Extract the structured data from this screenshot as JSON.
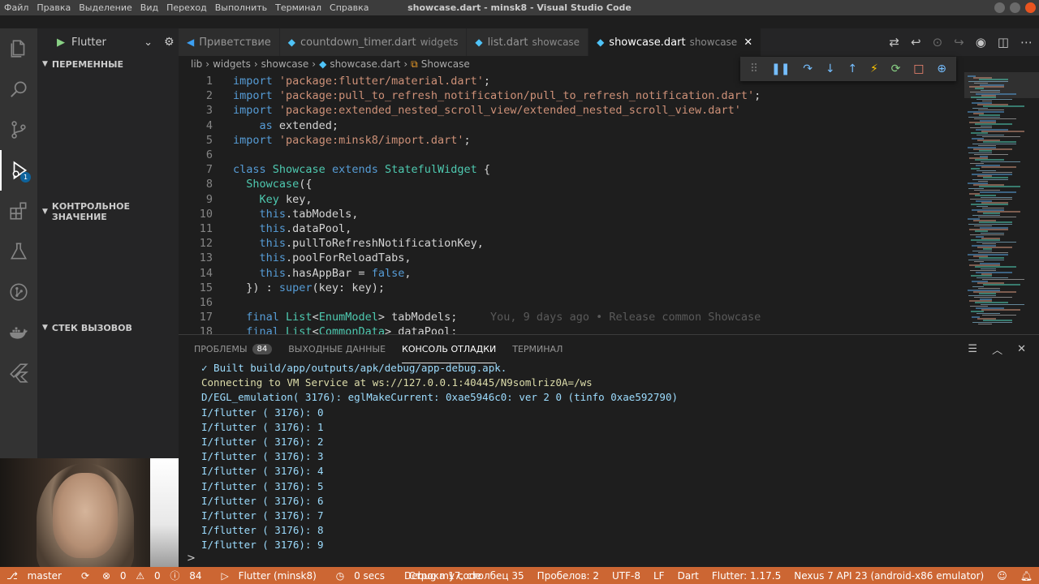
{
  "titlebar": {
    "menu": [
      "Файл",
      "Правка",
      "Выделение",
      "Вид",
      "Переход",
      "Выполнить",
      "Терминал",
      "Справка"
    ],
    "title": "showcase.dart - minsk8 - Visual Studio Code"
  },
  "activity": {
    "debug_badge": "1"
  },
  "sidebar": {
    "run_config": "Flutter",
    "sections": [
      "ПЕРЕМЕННЫЕ",
      "КОНТРОЛЬНОЕ ЗНАЧЕНИЕ",
      "СТЕК ВЫЗОВОВ"
    ]
  },
  "tabs": [
    {
      "name": "Приветствие",
      "sub": "",
      "icon": "vscode-icon"
    },
    {
      "name": "countdown_timer.dart",
      "sub": "widgets",
      "icon": "dart-icon"
    },
    {
      "name": "list.dart",
      "sub": "showcase",
      "icon": "dart-icon"
    },
    {
      "name": "showcase.dart",
      "sub": "showcase",
      "icon": "dart-icon",
      "active": true
    }
  ],
  "breadcrumb": [
    "lib",
    "widgets",
    "showcase",
    "showcase.dart",
    "Showcase"
  ],
  "editor": {
    "lines": [
      {
        "n": "1",
        "html": "<span class=\"kw\">import</span> <span class=\"str\">'package:flutter/material.dart'</span>;"
      },
      {
        "n": "2",
        "html": "<span class=\"kw\">import</span> <span class=\"str\">'package:pull_to_refresh_notification/pull_to_refresh_notification.dart'</span>;"
      },
      {
        "n": "3",
        "html": "<span class=\"kw\">import</span> <span class=\"str\">'package:extended_nested_scroll_view/extended_nested_scroll_view.dart'</span>"
      },
      {
        "n": "4",
        "html": "    <span class=\"kw\">as</span> extended;"
      },
      {
        "n": "5",
        "html": "<span class=\"kw\">import</span> <span class=\"str\">'package:minsk8/import.dart'</span>;"
      },
      {
        "n": "6",
        "html": ""
      },
      {
        "n": "7",
        "html": "<span class=\"kw\">class</span> <span class=\"cls\">Showcase</span> <span class=\"kw\">extends</span> <span class=\"cls\">StatefulWidget</span> {"
      },
      {
        "n": "8",
        "html": "  <span class=\"cls\">Showcase</span>({"
      },
      {
        "n": "9",
        "html": "    <span class=\"cls\">Key</span> key,"
      },
      {
        "n": "10",
        "html": "    <span class=\"kw\">this</span>.tabModels,"
      },
      {
        "n": "11",
        "html": "    <span class=\"kw\">this</span>.dataPool,"
      },
      {
        "n": "12",
        "html": "    <span class=\"kw\">this</span>.pullToRefreshNotificationKey,"
      },
      {
        "n": "13",
        "html": "    <span class=\"kw\">this</span>.poolForReloadTabs,"
      },
      {
        "n": "14",
        "html": "    <span class=\"kw\">this</span>.hasAppBar = <span class=\"kw\">false</span>,"
      },
      {
        "n": "15",
        "html": "  }) : <span class=\"kw\">super</span>(key: key);"
      },
      {
        "n": "16",
        "html": ""
      },
      {
        "n": "17",
        "html": "  <span class=\"kw\">final</span> <span class=\"cls\">List</span>&lt;<span class=\"cls\">EnumModel</span>&gt; tabModels;     <span class=\"blame\">You, 9 days ago • Release common Showcase</span>"
      },
      {
        "n": "18",
        "html": "  <span class=\"kw\">final</span> <span class=\"cls\">List</span>&lt;<span class=\"cls\">CommonData</span>&gt; dataPool;"
      }
    ]
  },
  "panel": {
    "tabs": [
      "ПРОБЛЕМЫ",
      "ВЫХОДНЫЕ ДАННЫЕ",
      "КОНСОЛЬ ОТЛАДКИ",
      "ТЕРМИНАЛ"
    ],
    "problems_count": "84",
    "console": [
      "✓ Built build/app/outputs/apk/debug/app-debug.apk.",
      "Connecting to VM Service at ws://127.0.0.1:40445/N9somlriz0A=/ws",
      "D/EGL_emulation( 3176): eglMakeCurrent: 0xae5946c0: ver 2 0 (tinfo 0xae592790)",
      "I/flutter ( 3176): 0",
      "I/flutter ( 3176): 1",
      "I/flutter ( 3176): 2",
      "I/flutter ( 3176): 3",
      "I/flutter ( 3176): 4",
      "I/flutter ( 3176): 5",
      "I/flutter ( 3176): 6",
      "I/flutter ( 3176): 7",
      "I/flutter ( 3176): 8",
      "I/flutter ( 3176): 9"
    ],
    "prompt": ">"
  },
  "statusbar": {
    "branch": "master",
    "errors": "0",
    "warnings": "0",
    "infos": "84",
    "session": "Flutter (minsk8)",
    "timer": "0 secs",
    "debug_mode": "Debug my code",
    "position": "Строка 17, столбец 35",
    "spaces": "Пробелов: 2",
    "encoding": "UTF-8",
    "eol": "LF",
    "language": "Dart",
    "flutter_version": "Flutter: 1.17.5",
    "device": "Nexus 7 API 23 (android-x86 emulator)"
  },
  "colors": {
    "statusbar_bg": "#cc6633",
    "keyword": "#569cd6",
    "string": "#ce9178",
    "class": "#4ec9b0"
  }
}
